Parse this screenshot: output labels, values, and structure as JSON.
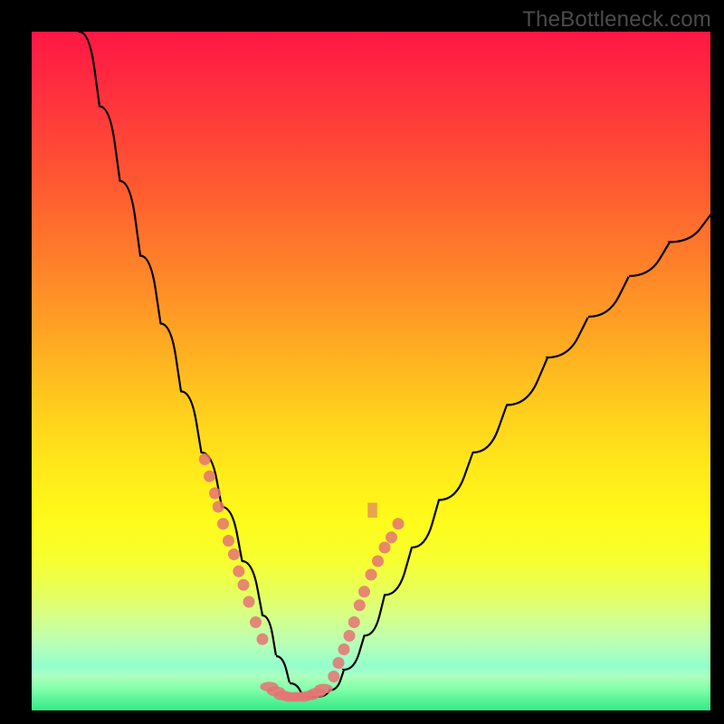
{
  "watermark": "TheBottleneck.com",
  "colors": {
    "marker": "#e57373",
    "curve": "#000000",
    "frame": "#000000"
  },
  "chart_data": {
    "type": "line",
    "title": "",
    "xlabel": "",
    "ylabel": "",
    "xlim": [
      0,
      100
    ],
    "ylim": [
      0,
      100
    ],
    "grid": false,
    "legend": false,
    "note": "X/Y are normalized to 0–100 inside the colored plot area. Y=0 at bottom (green), Y=100 at top (red). Curve represents bottleneck percentage vs some hardware parameter; minimum (best match) is around x≈35–42 where y≈2.",
    "series": [
      {
        "name": "bottleneck-curve",
        "x": [
          7,
          10,
          13,
          16,
          19,
          22,
          25,
          28,
          31,
          34,
          36,
          38,
          40,
          42,
          44,
          46,
          49,
          52,
          56,
          60,
          65,
          70,
          76,
          82,
          88,
          94,
          100
        ],
        "y": [
          100,
          89,
          78,
          67,
          57,
          47,
          38,
          30,
          22,
          14,
          8,
          4,
          2,
          2,
          3,
          6,
          11,
          17,
          24,
          31,
          38,
          45,
          52,
          58,
          64,
          69,
          73
        ]
      }
    ],
    "markers_left_branch": {
      "name": "scatter-left",
      "x": [
        25.5,
        26.2,
        27.0,
        27.5,
        28.2,
        29.0,
        29.8,
        30.5,
        31.2,
        32.0,
        33.0,
        34.0
      ],
      "y": [
        37,
        34.5,
        32,
        30,
        27.5,
        25,
        23,
        20.5,
        18.5,
        16,
        13,
        10.5
      ]
    },
    "markers_right_branch": {
      "name": "scatter-right",
      "x": [
        44.5,
        45.2,
        46.0,
        46.8,
        47.5,
        48.3,
        49.0,
        50.0,
        51.0,
        52.0,
        53.0,
        54.0
      ],
      "y": [
        5,
        7,
        9,
        11,
        13,
        15.5,
        17.5,
        20,
        22,
        24,
        25.5,
        27.5
      ]
    },
    "markers_valley": {
      "name": "valley-cluster",
      "x": [
        35,
        36,
        37,
        38,
        39,
        40,
        41,
        42,
        43
      ],
      "y": [
        3.5,
        2.8,
        2.2,
        2.0,
        2.0,
        2.0,
        2.2,
        2.6,
        3.2
      ]
    },
    "rect_marker": {
      "name": "small-anomaly-tick",
      "x": 50.2,
      "y": 29.5,
      "w": 1.4,
      "h": 2.2
    }
  }
}
